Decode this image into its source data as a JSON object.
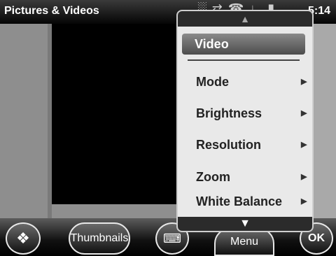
{
  "title_bar": {
    "app_title": "Pictures & Videos",
    "clock": "5:14",
    "status_icons": [
      "signal-icon",
      "sync-icon",
      "phone-icon",
      "volume-icon",
      "battery-icon"
    ]
  },
  "popup_menu": {
    "scroll_up_icon": "chevron-up-icon",
    "scroll_down_icon": "chevron-down-icon",
    "selected_item": "Video",
    "items": [
      {
        "label": "Mode",
        "submenu_icon": "triangle-right-icon"
      },
      {
        "label": "Brightness",
        "submenu_icon": "triangle-right-icon"
      },
      {
        "label": "Resolution",
        "submenu_icon": "triangle-right-icon"
      },
      {
        "label": "Zoom",
        "submenu_icon": "triangle-right-icon"
      },
      {
        "label": "White Balance",
        "submenu_icon": "triangle-right-icon"
      }
    ]
  },
  "softkeys": {
    "start_icon": "windows-logo-icon",
    "thumbnails_label": "Thumbnails",
    "keyboard_icon": "keyboard-icon",
    "menu_label": "Menu",
    "ok_label": "OK"
  }
}
